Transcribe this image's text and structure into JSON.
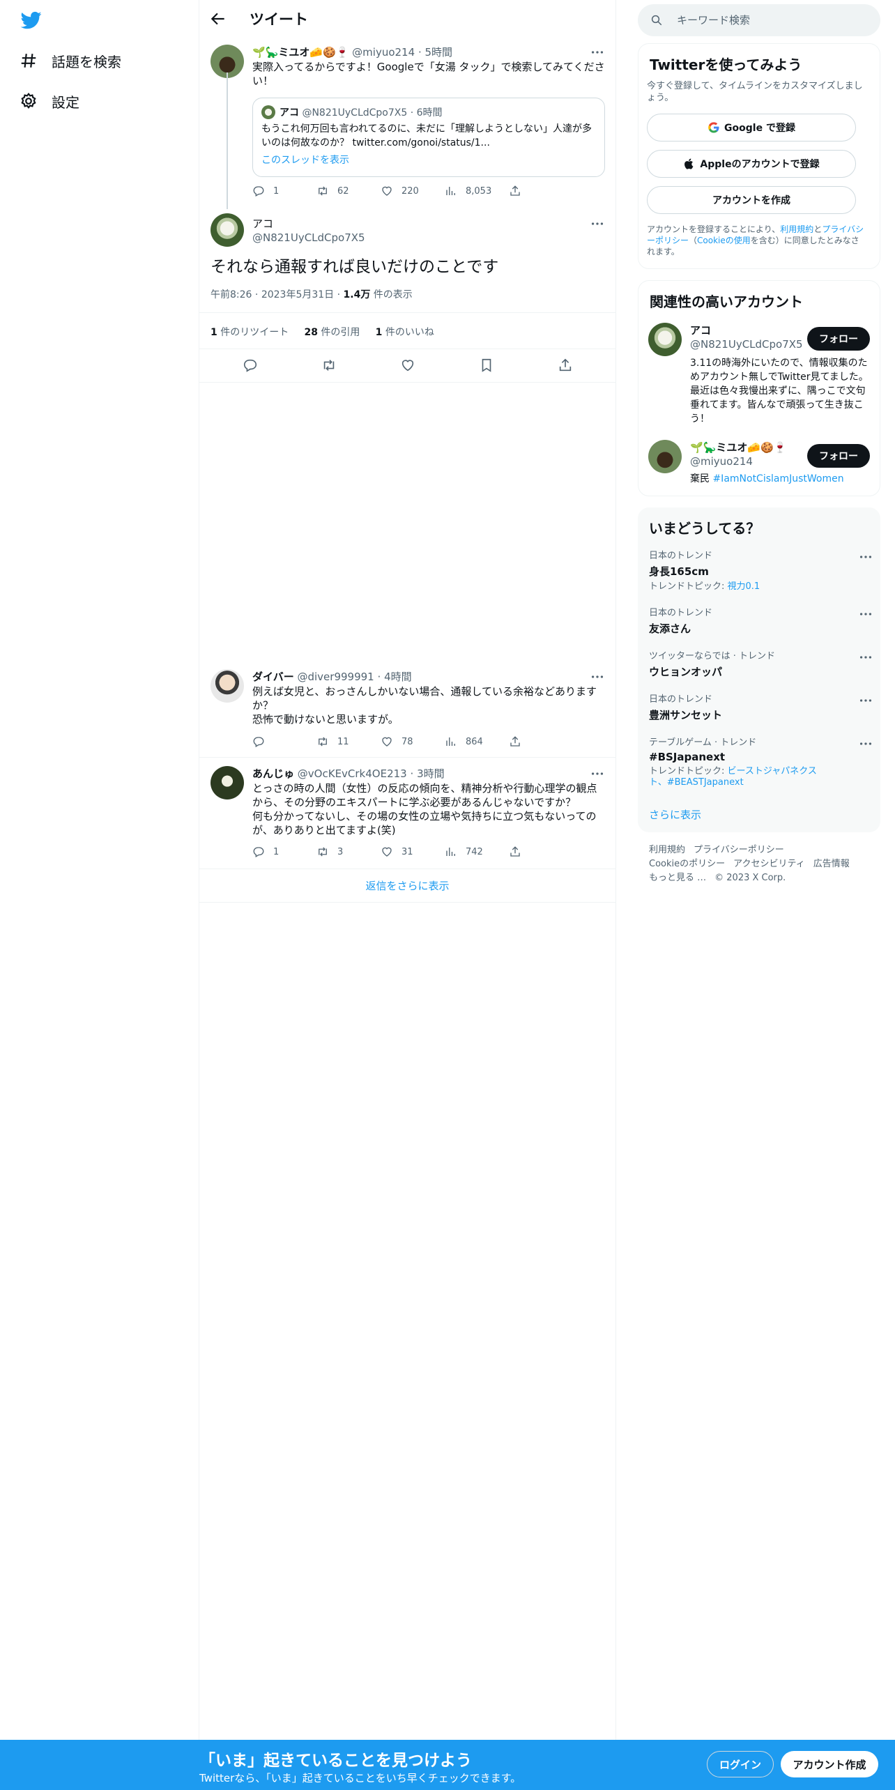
{
  "nav": {
    "explore_label": "話題を検索",
    "settings_label": "設定"
  },
  "header": {
    "title": "ツイート"
  },
  "parent_tweet": {
    "name": "🌱🦕ミユオ🧀🍪🍷",
    "handle": "@miyuo214",
    "time": "5時間",
    "text": "実際入ってるからですよ！Googleで「女湯 タック」で検索してみてください！",
    "quote": {
      "name": "アコ",
      "handle": "@N821UyCLdCpo7X5",
      "time": "6時間",
      "text": "もうこれ何万回も言われてるのに、未だに「理解しようとしない」人達が多いのは何故なのか？ twitter.com/gonoi/status/1...",
      "thread_link": "このスレッドを表示"
    },
    "replies": "1",
    "retweets": "62",
    "likes": "220",
    "views": "8,053"
  },
  "main_tweet": {
    "name": "アコ",
    "handle": "@N821UyCLdCpo7X5",
    "text": "それなら通報すれば良いだけのことです",
    "time": "午前8:26",
    "date": "2023年5月31日",
    "views_count": "1.4万",
    "views_label": "件の表示",
    "retweets_count": "1",
    "retweets_label": "件のリツイート",
    "quotes_count": "28",
    "quotes_label": "件の引用",
    "likes_count": "1",
    "likes_label": "件のいいね"
  },
  "replies": [
    {
      "name": "ダイバー",
      "handle": "@diver999991",
      "time": "4時間",
      "text": "例えば女児と、おっさんしかいない場合、通報している余裕などありますか？\n恐怖で動けないと思いますが。",
      "replies": "",
      "retweets": "11",
      "likes": "78",
      "views": "864"
    },
    {
      "name": "あんじゅ",
      "handle": "@vOcKEvCrk4OE213",
      "time": "3時間",
      "text": "とっさの時の人間（女性）の反応の傾向を、精神分析や行動心理学の観点から、その分野のエキスパートに学ぶ必要があるんじゃないですか？\n何も分かってないし、その場の女性の立場や気持ちに立つ気もないってのが、ありありと出てますよ(笑)",
      "replies": "1",
      "retweets": "3",
      "likes": "31",
      "views": "742"
    }
  ],
  "show_more_replies": "返信をさらに表示",
  "right": {
    "search_placeholder": "キーワード検索",
    "signup_card": {
      "title": "Twitterを使ってみよう",
      "subtitle": "今すぐ登録して、タイムラインをカスタマイズしましょう。",
      "google_btn": "Google で登録",
      "apple_btn": "Appleのアカウントで登録",
      "create_btn": "アカウントを作成",
      "legal_pre": "アカウントを登録することにより、",
      "legal_terms": "利用規約",
      "legal_and": "と",
      "legal_privacy": "プライバシーポリシー",
      "legal_paren_open": "（",
      "legal_cookie": "Cookieの使用",
      "legal_post": "を含む）に同意したとみなされます。"
    },
    "related": {
      "title": "関連性の高いアカウント",
      "accounts": [
        {
          "name": "アコ",
          "handle": "@N821UyCLdCpo7X5",
          "follow": "フォロー",
          "bio": "3.11の時海外にいたので、情報収集のためアカウント無しでTwitter見てました。最近は色々我慢出来ずに、隅っこで文句垂れてます。皆んなで頑張って生き抜こう！"
        },
        {
          "name": "🌱🦕ミユオ🧀🍪🍷",
          "handle": "@miyuo214",
          "follow": "フォロー",
          "bio_pre": "棄民 ",
          "bio_tag": "#IamNotCislamJustWomen"
        }
      ]
    },
    "trends": {
      "title": "いまどうしてる？",
      "items": [
        {
          "cat": "日本のトレンド",
          "title": "身長165cm",
          "sub_pre": "トレンドトピック: ",
          "sub_link": "視力0.1"
        },
        {
          "cat": "日本のトレンド",
          "title": "友添さん"
        },
        {
          "cat": "ツイッターならでは · トレンド",
          "title": "ウヒョンオッパ"
        },
        {
          "cat": "日本のトレンド",
          "title": "豊洲サンセット"
        },
        {
          "cat": "テーブルゲーム · トレンド",
          "title": "#BSJapanext",
          "sub_pre": "トレンドトピック: ",
          "sub_link": "ビーストジャパネクスト、#BEASTJapanext"
        }
      ],
      "show_more": "さらに表示"
    },
    "footer": {
      "terms": "利用規約",
      "privacy": "プライバシーポリシー",
      "cookie": "Cookieのポリシー",
      "accessibility": "アクセシビリティ",
      "ads": "広告情報",
      "more": "もっと見る …",
      "copyright": "© 2023 X Corp."
    }
  },
  "banner": {
    "headline": "「いま」起きていることを見つけよう",
    "sub": "Twitterなら、「いま」起きていることをいち早くチェックできます。",
    "login": "ログイン",
    "signup": "アカウント作成"
  },
  "colors": {
    "accent": "#1d9bf0",
    "text": "#0f1419",
    "muted": "#536471",
    "border": "#eff3f4"
  }
}
